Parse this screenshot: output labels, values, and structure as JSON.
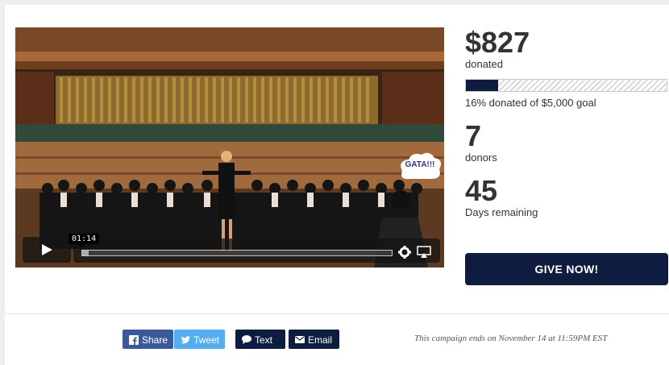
{
  "video": {
    "timecode": "01:14",
    "progress_fraction": 0.02,
    "sign_text": "GATA!!!",
    "controls": {
      "play_icon": "play-icon",
      "settings_icon": "gear-icon",
      "airplay_icon": "airplay-icon"
    }
  },
  "stats": {
    "amount": "$827",
    "amount_label": "donated",
    "progress_percent": 16,
    "goal_text": "16% donated of $5,000 goal",
    "donors": "7",
    "donors_label": "donors",
    "days": "45",
    "days_label": "Days remaining"
  },
  "give_button": "GIVE NOW!",
  "share": {
    "facebook": "Share",
    "twitter": "Tweet",
    "text": "Text",
    "email": "Email"
  },
  "campaign_end": "This campaign ends on November 14 at 11:59PM EST",
  "colors": {
    "navy": "#0e1d3f",
    "facebook": "#3b5998",
    "twitter": "#55acee"
  }
}
